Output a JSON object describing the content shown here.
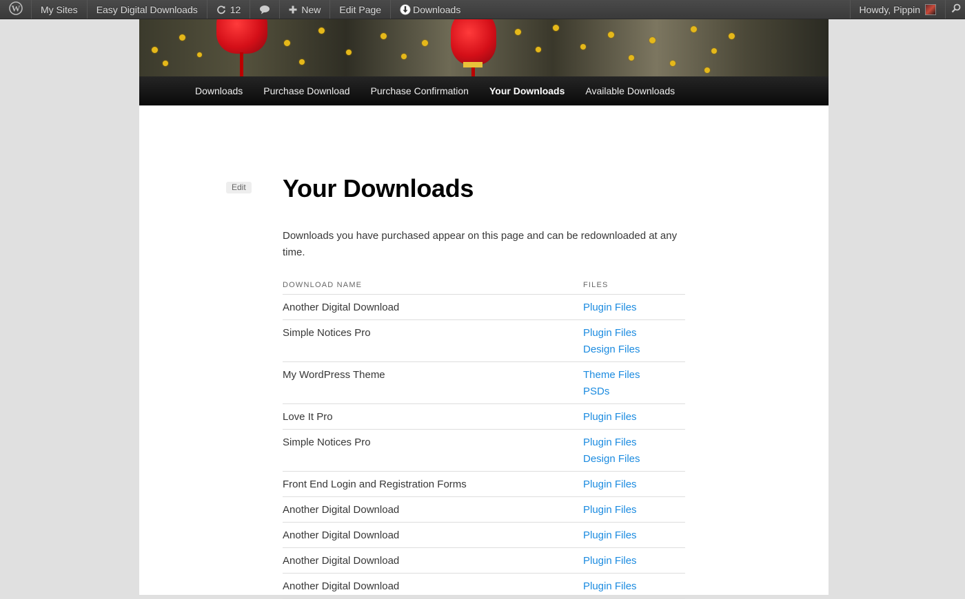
{
  "adminbar": {
    "wp_logo_icon": "wordpress-logo-icon",
    "my_sites": "My Sites",
    "site_name": "Easy Digital Downloads",
    "updates_count": "12",
    "updates_icon": "refresh-icon",
    "comments_icon": "comment-bubble-icon",
    "new_label": "New",
    "new_icon": "plus-icon",
    "edit_page": "Edit Page",
    "downloads_label": "Downloads",
    "downloads_icon": "download-icon",
    "howdy": "Howdy, Pippin",
    "search_icon": "search-icon"
  },
  "nav": {
    "items": [
      {
        "label": "Downloads"
      },
      {
        "label": "Purchase Download"
      },
      {
        "label": "Purchase Confirmation"
      },
      {
        "label": "Your Downloads"
      },
      {
        "label": "Available Downloads"
      }
    ],
    "current": "Your Downloads"
  },
  "entry": {
    "edit_label": "Edit",
    "title": "Your Downloads",
    "intro": "Downloads you have purchased appear on this page and can be redownloaded at any time."
  },
  "table": {
    "headers": {
      "name": "Download Name",
      "files": "Files"
    },
    "rows": [
      {
        "name": "Another Digital Download",
        "files": [
          "Plugin Files"
        ]
      },
      {
        "name": "Simple Notices Pro",
        "files": [
          "Plugin Files",
          "Design Files"
        ]
      },
      {
        "name": "My WordPress Theme",
        "files": [
          "Theme Files",
          "PSDs"
        ]
      },
      {
        "name": "Love It Pro",
        "files": [
          "Plugin Files"
        ]
      },
      {
        "name": "Simple Notices Pro",
        "files": [
          "Plugin Files",
          "Design Files"
        ]
      },
      {
        "name": "Front End Login and Registration Forms",
        "files": [
          "Plugin Files"
        ]
      },
      {
        "name": "Another Digital Download",
        "files": [
          "Plugin Files"
        ]
      },
      {
        "name": "Another Digital Download",
        "files": [
          "Plugin Files"
        ]
      },
      {
        "name": "Another Digital Download",
        "files": [
          "Plugin Files"
        ]
      },
      {
        "name": "Another Digital Download",
        "files": [
          "Plugin Files"
        ]
      }
    ]
  },
  "colors": {
    "link": "#1b8be0",
    "adminbar_bg": "#464646",
    "nav_bg": "#111111",
    "page_bg": "#e0e0e0"
  }
}
